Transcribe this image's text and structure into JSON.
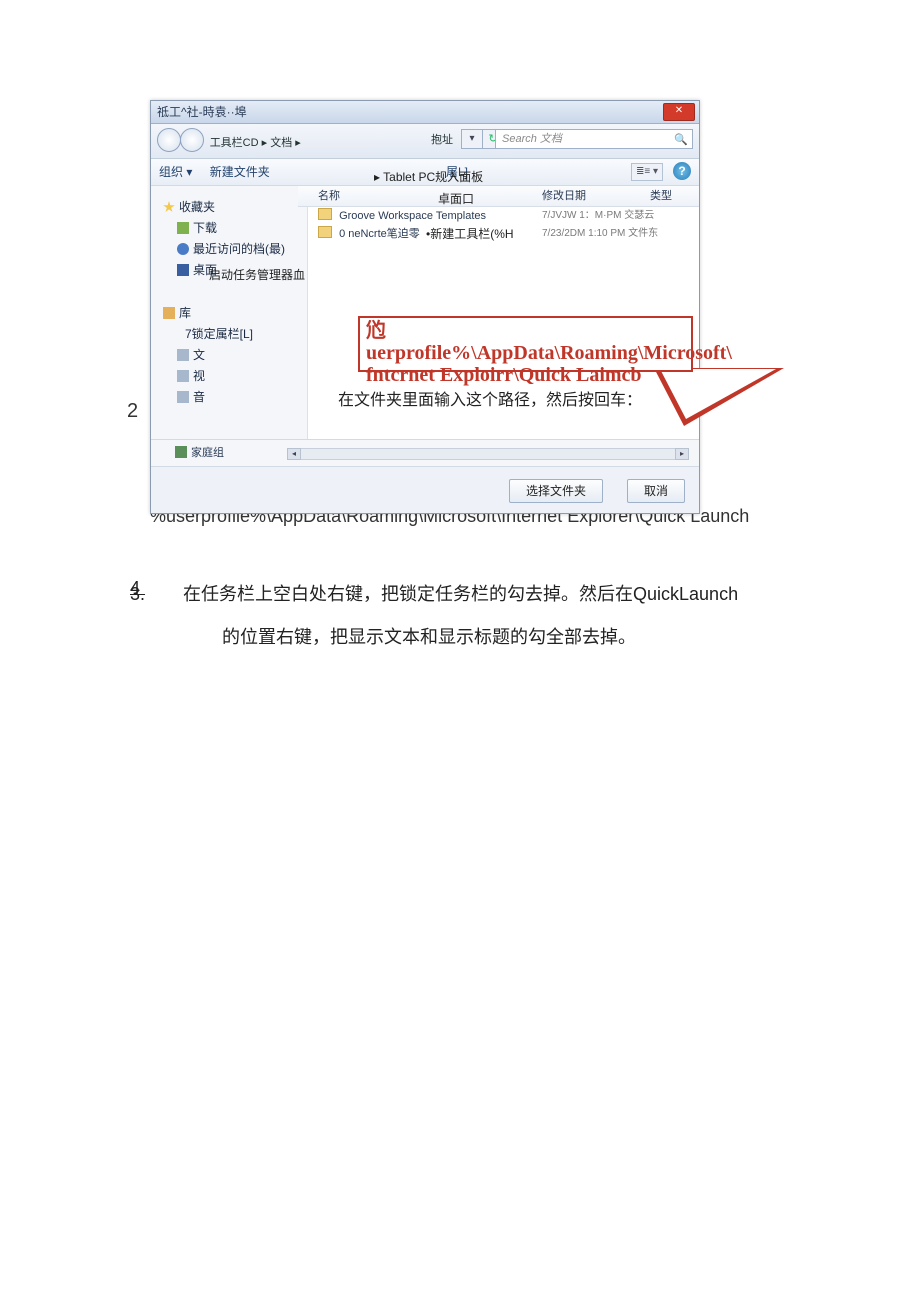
{
  "dialog": {
    "title": "祗工^社-時袁··埠",
    "close": "✕",
    "crumbs": "工具栏CD ▸ 文档 ▸",
    "addr_mid": "抱址",
    "dropdown": "▾",
    "refresh": "↻",
    "search_placeholder": "Search 文档",
    "toolbar": {
      "organize": "组织 ▾",
      "newfolder": "新建文件夹",
      "midlabel": "屠L]",
      "view": "≣≡ ▾",
      "help": "?"
    },
    "sidebar": {
      "favorites": "收藏夹",
      "download": "下载",
      "recent": "最近访问的档(最)",
      "desktop": "桌面",
      "library": "库",
      "lock": "7锁定属栏[L]",
      "sub1": "文",
      "sub2": "视",
      "sub3": "音",
      "homegroup": "家庭组",
      "taskmgr": "启动任务管理器血"
    },
    "overlay": {
      "tablet": "▸ Tablet PC规入面板",
      "desktop": "卓面口",
      "newtoolbar": "•新建工具栏(%H"
    },
    "cols": {
      "name": "名称",
      "date": "修改日期",
      "type": "类型"
    },
    "rows": [
      {
        "name": "Groove Workspace Templates",
        "date": "7/JVJW 1：M·PM 交瑟云",
        "type": ""
      },
      {
        "name": "0 neNcrte笔迫零",
        "date": "7/23/2DM 1:10 PM 文件东",
        "type": ""
      }
    ],
    "callout": {
      "line1": "尦uerprofile%\\AppData\\Roaming\\Microsoft\\",
      "line2": "fntcrnet Exploirr\\Quick Laimcb"
    },
    "instruction": "在文件夹里面输入这个路径，然后按回车：",
    "buttons": {
      "choose": "选择文件夹",
      "cancel": "取消"
    }
  },
  "step2_num": "2",
  "path_text": "%userprofile%\\AppData\\Roaming\\Microsoft\\Internet Explorer\\Quick Launch",
  "step3": {
    "num_strike": "3.",
    "num_over": "4",
    "line1": "在任务栏上空白处右键，把锁定任务栏的勾去掉。然后在QuickLaunch",
    "line2": "的位置右键，把显示文本和显示标题的勾全部去掉。"
  }
}
